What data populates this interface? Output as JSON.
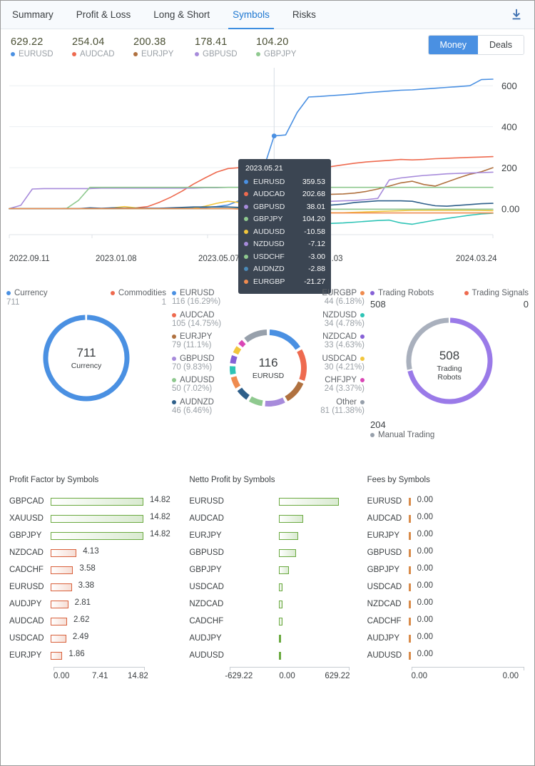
{
  "header": {
    "tabs": [
      {
        "label": "Summary",
        "active": false
      },
      {
        "label": "Profit & Loss",
        "active": false
      },
      {
        "label": "Long & Short",
        "active": false
      },
      {
        "label": "Symbols",
        "active": true
      },
      {
        "label": "Risks",
        "active": false
      }
    ],
    "download_icon": "download-icon"
  },
  "stats": [
    {
      "value": "629.22",
      "label": "EURUSD",
      "color": "#4a90e2"
    },
    {
      "value": "254.04",
      "label": "AUDCAD",
      "color": "#ee6a4f"
    },
    {
      "value": "200.38",
      "label": "EURJPY",
      "color": "#b0713f"
    },
    {
      "value": "178.41",
      "label": "GBPUSD",
      "color": "#a78bdb"
    },
    {
      "value": "104.20",
      "label": "GBPJPY",
      "color": "#8fc98f"
    }
  ],
  "toggle": {
    "money_label": "Money",
    "deals_label": "Deals",
    "selected": "Money"
  },
  "chart_data": {
    "type": "line",
    "title": "",
    "xlabel": "",
    "ylabel": "",
    "ylim": [
      -120,
      660
    ],
    "yticks": [
      "0.00",
      "200",
      "400",
      "600"
    ],
    "ytick_values": [
      0,
      200,
      400,
      600
    ],
    "xticks": [
      "2022.09.11",
      "2023.01.08",
      "2023.05.07",
      "2023.09.03",
      "2024.03.24"
    ],
    "grid": true,
    "legend_position": "top",
    "series": [
      {
        "name": "EURUSD",
        "color": "#4a90e2",
        "final": 629.22,
        "points": [
          0,
          0,
          0,
          0,
          0,
          0,
          0,
          0,
          0,
          0,
          0,
          0,
          2,
          2,
          2,
          2,
          4,
          6,
          10,
          18,
          40,
          95,
          180,
          355,
          360,
          470,
          545,
          548,
          552,
          556,
          560,
          566,
          570,
          574,
          578,
          580,
          584,
          588,
          592,
          596,
          600,
          630,
          632
        ]
      },
      {
        "name": "AUDCAD",
        "color": "#ee6a4f",
        "final": 254.04,
        "points": [
          0,
          0,
          0,
          0,
          0,
          0,
          0,
          0,
          0,
          1,
          2,
          4,
          10,
          30,
          55,
          85,
          120,
          150,
          178,
          196,
          200,
          202,
          203,
          203,
          203,
          200,
          196,
          200,
          206,
          214,
          222,
          228,
          232,
          236,
          240,
          238,
          240,
          244,
          246,
          248,
          250,
          252,
          254
        ]
      },
      {
        "name": "EURJPY",
        "color": "#b0713f",
        "final": 200.38,
        "points": [
          0,
          0,
          0,
          0,
          0,
          0,
          0,
          0,
          0,
          0,
          0,
          0,
          0,
          0,
          0,
          0,
          0,
          0,
          0,
          0,
          0,
          -5,
          -8,
          -10,
          -6,
          60,
          68,
          70,
          70,
          72,
          76,
          84,
          96,
          110,
          126,
          134,
          118,
          110,
          130,
          150,
          168,
          180,
          200
        ]
      },
      {
        "name": "GBPUSD",
        "color": "#a78bdb",
        "final": 178.41,
        "points": [
          0,
          16,
          96,
          98,
          98,
          98,
          98,
          98,
          100,
          100,
          100,
          100,
          100,
          100,
          100,
          100,
          100,
          102,
          102,
          104,
          104,
          106,
          36,
          30,
          24,
          30,
          34,
          36,
          36,
          38,
          40,
          44,
          50,
          140,
          150,
          156,
          162,
          166,
          170,
          172,
          174,
          176,
          178
        ]
      },
      {
        "name": "GBPJPY",
        "color": "#8fc98f",
        "final": 104.2,
        "points": [
          0,
          0,
          0,
          0,
          0,
          2,
          40,
          104,
          104,
          104,
          104,
          104,
          104,
          104,
          104,
          104,
          104,
          104,
          104,
          104,
          104,
          104,
          104,
          104,
          104,
          104,
          104,
          104,
          104,
          104,
          104,
          104,
          104,
          104,
          104,
          104,
          104,
          104,
          104,
          104,
          104,
          104,
          104
        ]
      },
      {
        "name": "AUDUSD",
        "color": "#f2c63c",
        "final": -10.58,
        "points": [
          0,
          0,
          0,
          0,
          0,
          0,
          0,
          0,
          0,
          4,
          10,
          4,
          0,
          0,
          0,
          0,
          2,
          12,
          26,
          36,
          30,
          14,
          -6,
          -10,
          -12,
          -14,
          -16,
          -18,
          -20,
          -20,
          -18,
          -16,
          -14,
          -12,
          -10,
          -8,
          -8,
          -8,
          -8,
          -8,
          -8,
          -9,
          -10
        ]
      },
      {
        "name": "NZDUSD",
        "color": "#2ec4b6",
        "final": -7.12,
        "points": [
          0,
          0,
          0,
          0,
          0,
          0,
          0,
          0,
          0,
          0,
          0,
          0,
          0,
          0,
          0,
          0,
          0,
          0,
          0,
          0,
          0,
          0,
          -20,
          -60,
          -82,
          -110,
          -98,
          -78,
          -72,
          -70,
          -66,
          -62,
          -58,
          -56,
          -70,
          -76,
          -66,
          -56,
          -48,
          -40,
          -32,
          -26,
          -22
        ]
      },
      {
        "name": "USDCHF",
        "color": "#8fc98f",
        "final": -3.0,
        "points": [
          0,
          0,
          0,
          0,
          0,
          0,
          0,
          0,
          0,
          0,
          0,
          0,
          0,
          0,
          0,
          0,
          0,
          0,
          0,
          0,
          0,
          0,
          -2,
          -3,
          -3,
          -3,
          -3,
          -3,
          -3,
          -3,
          -3,
          -3,
          -3,
          -3,
          -3,
          -3,
          -3,
          -3,
          -3,
          -3,
          -3,
          -3,
          -3
        ]
      },
      {
        "name": "AUDNZD",
        "color": "#2e5f8a",
        "final": -2.88,
        "points": [
          0,
          0,
          0,
          0,
          0,
          0,
          0,
          4,
          2,
          4,
          2,
          2,
          2,
          2,
          4,
          6,
          8,
          8,
          8,
          8,
          6,
          4,
          -2,
          -3,
          -3,
          4,
          10,
          14,
          18,
          22,
          30,
          34,
          38,
          38,
          38,
          36,
          24,
          14,
          12,
          16,
          20,
          24,
          26
        ]
      },
      {
        "name": "EURGBP",
        "color": "#ef8b4f",
        "final": -21.27,
        "points": [
          0,
          0,
          0,
          0,
          0,
          0,
          0,
          0,
          0,
          0,
          0,
          0,
          0,
          0,
          0,
          0,
          0,
          0,
          0,
          0,
          -2,
          -10,
          -20,
          -21,
          -21,
          -21,
          -21,
          -21,
          -21,
          -21,
          -21,
          -21,
          -21,
          -21,
          -21,
          -21,
          -21,
          -21,
          -21,
          -21,
          -21,
          -21,
          -21
        ]
      }
    ],
    "tooltip": {
      "date": "2023.05.21",
      "rows": [
        {
          "name": "EURUSD",
          "value": "359.53",
          "color": "#4a90e2"
        },
        {
          "name": "AUDCAD",
          "value": "202.68",
          "color": "#ee6a4f"
        },
        {
          "name": "GBPUSD",
          "value": "38.01",
          "color": "#a78bdb"
        },
        {
          "name": "GBPJPY",
          "value": "104.20",
          "color": "#8fc98f"
        },
        {
          "name": "AUDUSD",
          "value": "-10.58",
          "color": "#f2c63c"
        },
        {
          "name": "NZDUSD",
          "value": "-7.12",
          "color": "#a78bdb"
        },
        {
          "name": "USDCHF",
          "value": "-3.00",
          "color": "#8fc98f"
        },
        {
          "name": "AUDNZD",
          "value": "-2.88",
          "color": "#4a8ab8"
        },
        {
          "name": "EURGBP",
          "value": "-21.27",
          "color": "#ef8b4f"
        }
      ]
    }
  },
  "donut_currency": {
    "type": "pie",
    "center_value": "711",
    "center_label": "Currency",
    "legend": [
      {
        "label": "Currency",
        "value": "711",
        "color": "#4a90e2"
      },
      {
        "label": "Commodities",
        "value": "1",
        "color": "#ee6a4f"
      }
    ],
    "slices": [
      {
        "name": "Currency",
        "value": 711,
        "color": "#4a90e2"
      },
      {
        "name": "Commodities",
        "value": 1,
        "color": "#ee6a4f"
      }
    ]
  },
  "donut_symbols": {
    "type": "pie",
    "center_value": "116",
    "center_label": "EURUSD",
    "left_legend": [
      {
        "label": "EURUSD",
        "value": "116 (16.29%)",
        "color": "#4a90e2"
      },
      {
        "label": "AUDCAD",
        "value": "105 (14.75%)",
        "color": "#ee6a4f"
      },
      {
        "label": "EURJPY",
        "value": "79 (11.1%)",
        "color": "#b0713f"
      },
      {
        "label": "GBPUSD",
        "value": "70 (9.83%)",
        "color": "#a78bdb"
      },
      {
        "label": "AUDUSD",
        "value": "50 (7.02%)",
        "color": "#8fc98f"
      },
      {
        "label": "AUDNZD",
        "value": "46 (6.46%)",
        "color": "#2e5f8a"
      }
    ],
    "right_legend": [
      {
        "label": "EURGBP",
        "value": "44 (6.18%)",
        "color": "#ef8b4f"
      },
      {
        "label": "NZDUSD",
        "value": "34 (4.78%)",
        "color": "#2ec4b6"
      },
      {
        "label": "NZDCAD",
        "value": "33 (4.63%)",
        "color": "#8661d6"
      },
      {
        "label": "USDCAD",
        "value": "30 (4.21%)",
        "color": "#f2c63c"
      },
      {
        "label": "CHFJPY",
        "value": "24 (3.37%)",
        "color": "#d946b5"
      },
      {
        "label": "Other",
        "value": "81 (11.38%)",
        "color": "#97a0ab"
      }
    ],
    "slices": [
      {
        "name": "EURUSD",
        "value": 116,
        "color": "#4a90e2"
      },
      {
        "name": "AUDCAD",
        "value": 105,
        "color": "#ee6a4f"
      },
      {
        "name": "EURJPY",
        "value": 79,
        "color": "#b0713f"
      },
      {
        "name": "GBPUSD",
        "value": 70,
        "color": "#a78bdb"
      },
      {
        "name": "AUDUSD",
        "value": 50,
        "color": "#8fc98f"
      },
      {
        "name": "AUDNZD",
        "value": 46,
        "color": "#2e5f8a"
      },
      {
        "name": "EURGBP",
        "value": 44,
        "color": "#ef8b4f"
      },
      {
        "name": "NZDUSD",
        "value": 34,
        "color": "#2ec4b6"
      },
      {
        "name": "NZDCAD",
        "value": 33,
        "color": "#8661d6"
      },
      {
        "name": "USDCAD",
        "value": 30,
        "color": "#f2c63c"
      },
      {
        "name": "CHFJPY",
        "value": 24,
        "color": "#d946b5"
      },
      {
        "name": "Other",
        "value": 81,
        "color": "#97a0ab"
      }
    ]
  },
  "donut_robots": {
    "type": "pie",
    "center_value": "508",
    "center_label_line1": "Trading",
    "center_label_line2": "Robots",
    "top_legend": [
      {
        "label": "Trading Robots",
        "value": "508",
        "color": "#8661d6"
      },
      {
        "label": "Trading Signals",
        "value": "0",
        "color": "#ee6a4f"
      }
    ],
    "bottom_legend": {
      "value": "204",
      "label": "Manual Trading",
      "color": "#97a0ab"
    },
    "slices": [
      {
        "name": "Trading Robots",
        "value": 508,
        "color": "#9a7ae8"
      },
      {
        "name": "Manual Trading",
        "value": 204,
        "color": "#a9b0bd"
      }
    ]
  },
  "bar_profit_factor": {
    "type": "bar",
    "title": "Profit Factor by Symbols",
    "axis_ticks": [
      "0.00",
      "7.41",
      "14.82"
    ],
    "axis_min": 0,
    "axis_max": 14.82,
    "rows": [
      {
        "label": "GBPCAD",
        "value": 14.82,
        "display": "14.82",
        "style": "green"
      },
      {
        "label": "XAUUSD",
        "value": 14.82,
        "display": "14.82",
        "style": "green"
      },
      {
        "label": "GBPJPY",
        "value": 14.82,
        "display": "14.82",
        "style": "green"
      },
      {
        "label": "NZDCAD",
        "value": 4.13,
        "display": "4.13",
        "style": "red"
      },
      {
        "label": "CADCHF",
        "value": 3.58,
        "display": "3.58",
        "style": "red"
      },
      {
        "label": "EURUSD",
        "value": 3.38,
        "display": "3.38",
        "style": "red"
      },
      {
        "label": "AUDJPY",
        "value": 2.81,
        "display": "2.81",
        "style": "red"
      },
      {
        "label": "AUDCAD",
        "value": 2.62,
        "display": "2.62",
        "style": "red"
      },
      {
        "label": "USDCAD",
        "value": 2.49,
        "display": "2.49",
        "style": "red"
      },
      {
        "label": "EURJPY",
        "value": 1.86,
        "display": "1.86",
        "style": "red"
      }
    ]
  },
  "bar_netto_profit": {
    "type": "bar",
    "title": "Netto Profit by Symbols",
    "axis_ticks": [
      "-629.22",
      "0.00",
      "629.22"
    ],
    "axis_min": -629.22,
    "axis_max": 629.22,
    "rows": [
      {
        "label": "EURUSD",
        "value": 629.22,
        "style": "green"
      },
      {
        "label": "AUDCAD",
        "value": 254.04,
        "style": "green"
      },
      {
        "label": "EURJPY",
        "value": 200.38,
        "style": "green"
      },
      {
        "label": "GBPUSD",
        "value": 178.41,
        "style": "green"
      },
      {
        "label": "GBPJPY",
        "value": 104.2,
        "style": "green"
      },
      {
        "label": "USDCAD",
        "value": 38.0,
        "style": "green"
      },
      {
        "label": "NZDCAD",
        "value": 36.0,
        "style": "green"
      },
      {
        "label": "CADCHF",
        "value": 34.0,
        "style": "green"
      },
      {
        "label": "AUDJPY",
        "value": 10.0,
        "style": "solidg"
      },
      {
        "label": "AUDUSD",
        "value": 9.0,
        "style": "solidg"
      }
    ]
  },
  "bar_fees": {
    "type": "bar",
    "title": "Fees by Symbols",
    "axis_ticks": [
      "0.00",
      "0.00"
    ],
    "axis_min": 0,
    "axis_max": 0,
    "rows": [
      {
        "label": "EURUSD",
        "display": "0.00"
      },
      {
        "label": "AUDCAD",
        "display": "0.00"
      },
      {
        "label": "EURJPY",
        "display": "0.00"
      },
      {
        "label": "GBPUSD",
        "display": "0.00"
      },
      {
        "label": "GBPJPY",
        "display": "0.00"
      },
      {
        "label": "USDCAD",
        "display": "0.00"
      },
      {
        "label": "NZDCAD",
        "display": "0.00"
      },
      {
        "label": "CADCHF",
        "display": "0.00"
      },
      {
        "label": "AUDJPY",
        "display": "0.00"
      },
      {
        "label": "AUDUSD",
        "display": "0.00"
      }
    ]
  }
}
